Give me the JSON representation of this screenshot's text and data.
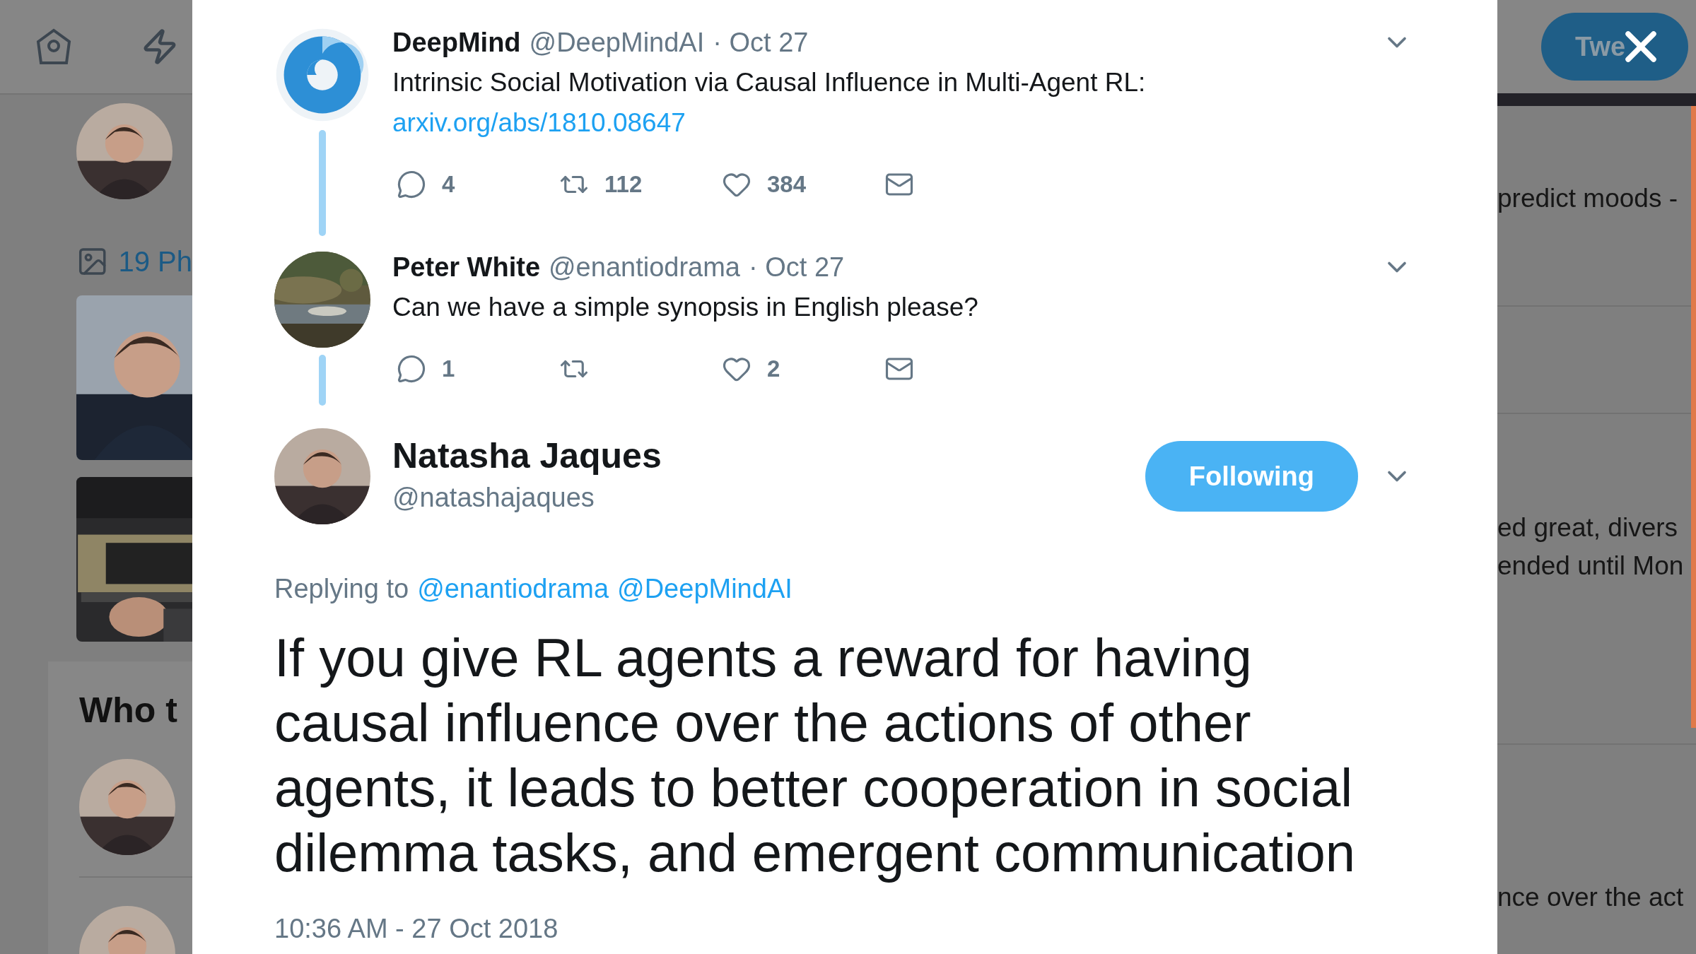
{
  "left_panel": {
    "photos_link": "19 Ph",
    "who_to_follow_title": "Who t"
  },
  "right_panel": {
    "tweet_button": "Twe",
    "snippets": [
      "predict moods -",
      "ed great, divers",
      "ended until Mon",
      "nce over the act"
    ]
  },
  "thread": [
    {
      "avatar": {
        "kind": "logo"
      },
      "name": "DeepMind",
      "handle": "@DeepMindAI",
      "date": "· Oct 27",
      "text": "Intrinsic Social Motivation via Causal Influence in Multi-Agent RL:",
      "link": "arxiv.org/abs/1810.08647",
      "actions": [
        {
          "kind": "reply",
          "count": "4"
        },
        {
          "kind": "retweet",
          "count": "112"
        },
        {
          "kind": "like",
          "count": "384"
        },
        {
          "kind": "message"
        }
      ]
    },
    {
      "name": "Peter White",
      "handle": "@enantiodrama",
      "date": "· Oct 27",
      "text": "Can we have a simple synopsis in English please?",
      "actions": [
        {
          "kind": "reply",
          "count": "1"
        },
        {
          "kind": "retweet"
        },
        {
          "kind": "like",
          "count": "2"
        },
        {
          "kind": "message"
        }
      ]
    }
  ],
  "main_tweet": {
    "name": "Natasha Jaques",
    "handle": "@natashajaques",
    "follow_button": "Following",
    "replying_label": "Replying to",
    "mentions": [
      "@enantiodrama",
      "@DeepMindAI"
    ],
    "text": "If you give RL agents a reward for having causal influence over the actions of other agents, it leads to better cooperation in social dilemma tasks, and emergent communication",
    "timestamp": "10:36 AM - 27 Oct 2018"
  }
}
